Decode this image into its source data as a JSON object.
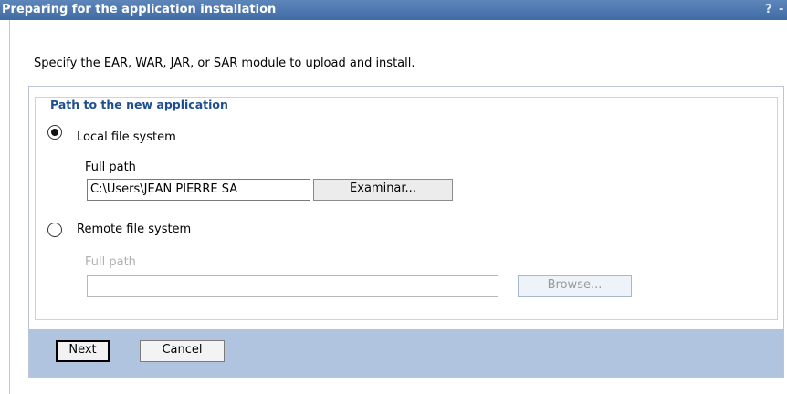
{
  "window": {
    "title": "Preparing for the application installation",
    "help_glyph": "?",
    "minimize_glyph": "-"
  },
  "instruction": "Specify the EAR, WAR, JAR, or SAR module to upload and install.",
  "path_group": {
    "legend": "Path to the new application",
    "local": {
      "label": "Local file system",
      "selected": true,
      "full_path_label": "Full path",
      "full_path_value": "C:\\Users\\JEAN PIERRE SA",
      "browse_button": "Examinar..."
    },
    "remote": {
      "label": "Remote file system",
      "selected": false,
      "full_path_label": "Full path",
      "full_path_value": "",
      "browse_button": "Browse..."
    }
  },
  "actions": {
    "next": "Next",
    "cancel": "Cancel"
  },
  "colors": {
    "titlebar": "#4a76ad",
    "legend_text": "#1f4f8f",
    "action_bar": "#b0c4df"
  }
}
